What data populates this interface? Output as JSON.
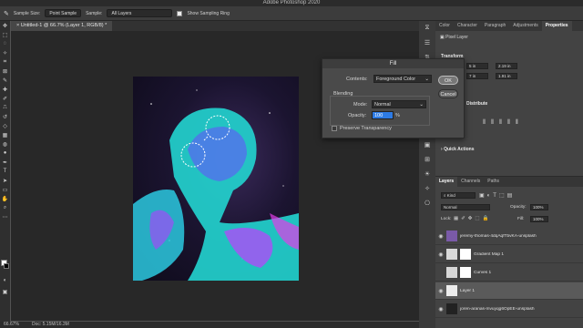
{
  "app": {
    "title": "Adobe Photoshop 2020"
  },
  "options_bar": {
    "sample_size_label": "Sample Size:",
    "sample_size_value": "Point Sample",
    "sample_label": "Sample:",
    "sample_value": "All Layers",
    "show_ring_label": "Show Sampling Ring"
  },
  "document": {
    "tab_label": "Untitled-1 @ 66.7% (Layer 1, RGB/8) *"
  },
  "status": {
    "zoom": "66.67%",
    "doc_info": "Doc: 5.15M/16.3M"
  },
  "panel": {
    "tabs": [
      "Color",
      "Character",
      "Paragraph",
      "Adjustments",
      "Properties"
    ],
    "active_tab": "Properties",
    "pixel_layer_label": "Pixel Layer",
    "transform_label": "Transform",
    "w_value": "5 in",
    "x_value": "2.19 in",
    "h_value": "7 in",
    "y_value": "1.91 in",
    "distribute_label": "Distribute",
    "quick_actions_label": "Quick Actions"
  },
  "layers_panel": {
    "tabs": [
      "Layers",
      "Channels",
      "Paths"
    ],
    "kind_label": "Kind",
    "blend_mode": "Normal",
    "opacity_label": "Opacity:",
    "opacity_value": "100%",
    "lock_label": "Lock:",
    "fill_label": "Fill:",
    "fill_value": "100%",
    "layers": [
      {
        "name": "jeremy-thomas-4dqAqfTbvKA-unsplash",
        "visible": true,
        "selected": false
      },
      {
        "name": "Gradient Map 1",
        "visible": true,
        "selected": false
      },
      {
        "name": "Curves 1",
        "visible": false,
        "selected": false
      },
      {
        "name": "Layer 1",
        "visible": true,
        "selected": true
      },
      {
        "name": "joren-aranas-mvuyqg6OpEE-unsplash",
        "visible": true,
        "selected": false
      }
    ]
  },
  "fill_dialog": {
    "title": "Fill",
    "contents_label": "Contents:",
    "contents_value": "Foreground Color",
    "blending_label": "Blending",
    "mode_label": "Mode:",
    "mode_value": "Normal",
    "opacity_label": "Opacity:",
    "opacity_value": "100",
    "opacity_unit": "%",
    "preserve_label": "Preserve Transparency",
    "ok_label": "OK",
    "cancel_label": "Cancel"
  },
  "colors": {
    "accent_blue": "#2d7be5",
    "artwork_cyan": "#2ee6d6",
    "artwork_purple": "#b23cff"
  }
}
